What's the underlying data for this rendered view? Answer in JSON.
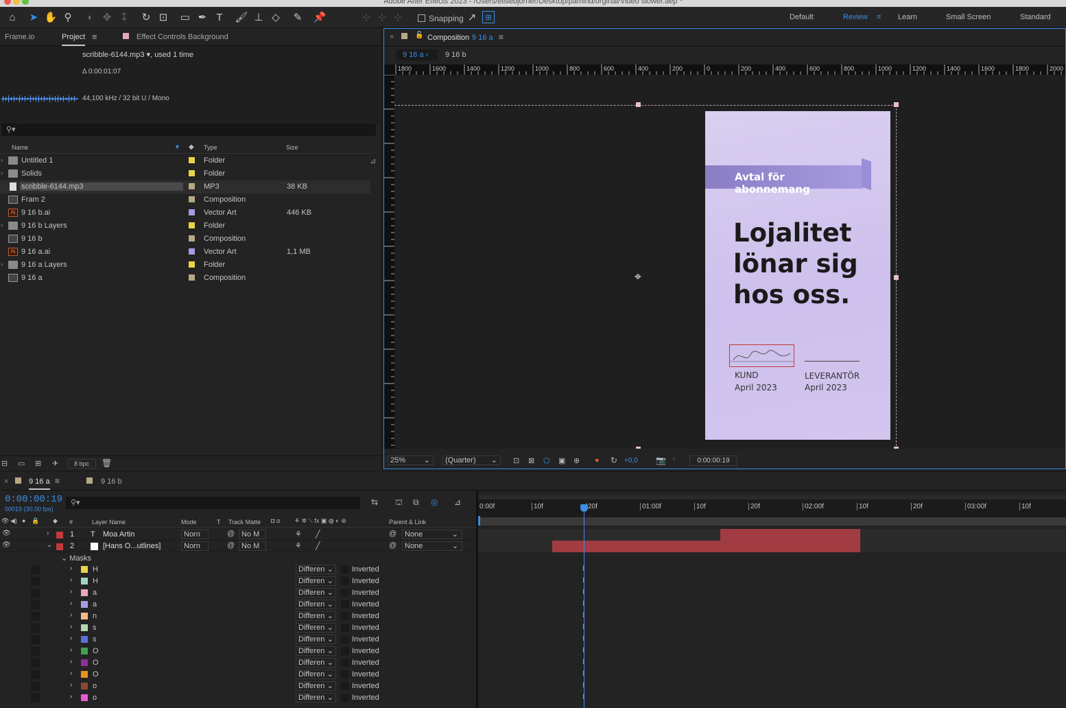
{
  "window": {
    "title": "Adobe After Effects 2023 - /Users/elisebjorner/Desktop/pamind/orginal/Video slower.aep *"
  },
  "toolbar": {
    "snapping_label": "Snapping",
    "workspaces": [
      "Default",
      "Review",
      "Learn",
      "Small Screen",
      "Standard"
    ],
    "active_workspace": "Review"
  },
  "project_panel": {
    "tabs": [
      "Frame.io",
      "Project",
      "Effect Controls Background"
    ],
    "active_tab": "Project",
    "selected_file": "scribble-6144.mp3",
    "used_text": ", used 1 time",
    "duration": "Δ 0:00:01:07",
    "audio_info": "44,100 kHz / 32 bit U / Mono",
    "columns": {
      "name": "Name",
      "type": "Type",
      "size": "Size"
    },
    "items": [
      {
        "name": "Untitled 1",
        "type": "Folder",
        "size": "",
        "swatch": "#e6d44a",
        "icon": "folder-icon"
      },
      {
        "name": "Solids",
        "type": "Folder",
        "size": "",
        "swatch": "#e6d44a",
        "icon": "folder-icon"
      },
      {
        "name": "scribble-6144.mp3",
        "type": "MP3",
        "size": "38 KB",
        "swatch": "#b7a986",
        "icon": "audio-file-icon"
      },
      {
        "name": "Fram 2",
        "type": "Composition",
        "size": "",
        "swatch": "#b7a986",
        "icon": "composition-icon"
      },
      {
        "name": "9 16 b.ai",
        "type": "Vector Art",
        "size": "446 KB",
        "swatch": "#a79be0",
        "icon": "illustrator-file-icon"
      },
      {
        "name": "9 16 b Layers",
        "type": "Folder",
        "size": "",
        "swatch": "#e6d44a",
        "icon": "folder-icon"
      },
      {
        "name": "9 16 b",
        "type": "Composition",
        "size": "",
        "swatch": "#b7a986",
        "icon": "composition-icon"
      },
      {
        "name": "9 16 a.ai",
        "type": "Vector Art",
        "size": "1,1 MB",
        "swatch": "#a79be0",
        "icon": "illustrator-file-icon"
      },
      {
        "name": "9 16 a Layers",
        "type": "Folder",
        "size": "",
        "swatch": "#e6d44a",
        "icon": "folder-icon"
      },
      {
        "name": "9 16 a",
        "type": "Composition",
        "size": "",
        "swatch": "#b7a986",
        "icon": "composition-icon"
      }
    ],
    "bpc": "8 bpc"
  },
  "composition_panel": {
    "title": "Composition",
    "comp_name": "9 16 a",
    "breadcrumbs": [
      "9 16 a",
      "9 16 b"
    ],
    "ruler_labels": [
      "1800",
      "1600",
      "1400",
      "1200",
      "1000",
      "800",
      "600",
      "400",
      "200",
      "0",
      "200",
      "400",
      "600",
      "800",
      "1000",
      "1200",
      "1400",
      "1600",
      "1800",
      "2000"
    ],
    "zoom": "25%",
    "resolution": "(Quarter)",
    "exposure": "+0,0",
    "timecode": "0:00:00:19",
    "card": {
      "banner": "Avtal för abonnemang",
      "headline": [
        "Lojalitet",
        "lönar sig",
        "hos oss."
      ],
      "left_label": "KUND",
      "left_date": "April 2023",
      "right_label": "LEVERANTÖR",
      "right_date": "April 2023"
    }
  },
  "timeline": {
    "tabs": [
      "9 16 a",
      "9 16 b"
    ],
    "timecode": "0:00:00:19",
    "frames_info": "00019 (30.00 fps)",
    "columns": {
      "num": "#",
      "layer_name": "Layer Name",
      "mode": "Mode",
      "t": "T",
      "track_matte": "Track Matte",
      "parent": "Parent & Link"
    },
    "ruler_labels": [
      "0:00f",
      "10f",
      "20f",
      "01:00f",
      "10f",
      "20f",
      "02:00f",
      "10f",
      "20f",
      "03:00f",
      "10f"
    ],
    "layers": [
      {
        "num": "1",
        "name": "Moa Artin",
        "mode": "Norn",
        "matte": "No M",
        "parent": "None",
        "color": "#c0393b"
      },
      {
        "num": "2",
        "name": "[Hans O...utlines]",
        "mode": "Norn",
        "matte": "No M",
        "parent": "None",
        "color": "#c0393b"
      }
    ],
    "masks_label": "Masks",
    "masks": [
      {
        "name": "H",
        "color": "#e6d44a",
        "mode": "Differen",
        "inverted": "Inverted"
      },
      {
        "name": "H",
        "color": "#9fd3c7",
        "mode": "Differen",
        "inverted": "Inverted"
      },
      {
        "name": "a",
        "color": "#e7a7c0",
        "mode": "Differen",
        "inverted": "Inverted"
      },
      {
        "name": "a",
        "color": "#a79be0",
        "mode": "Differen",
        "inverted": "Inverted"
      },
      {
        "name": "n",
        "color": "#f2b98a",
        "mode": "Differen",
        "inverted": "Inverted"
      },
      {
        "name": "s",
        "color": "#b5d6b0",
        "mode": "Differen",
        "inverted": "Inverted"
      },
      {
        "name": "s",
        "color": "#5a6fd8",
        "mode": "Differen",
        "inverted": "Inverted"
      },
      {
        "name": "O",
        "color": "#3fa34d",
        "mode": "Differen",
        "inverted": "Inverted"
      },
      {
        "name": "O",
        "color": "#8e2f9a",
        "mode": "Differen",
        "inverted": "Inverted"
      },
      {
        "name": "O",
        "color": "#e8921e",
        "mode": "Differen",
        "inverted": "Inverted"
      },
      {
        "name": "o",
        "color": "#8a4a32",
        "mode": "Differen",
        "inverted": "Inverted"
      },
      {
        "name": "o",
        "color": "#e85ad0",
        "mode": "Differen",
        "inverted": "Inverted"
      }
    ]
  }
}
